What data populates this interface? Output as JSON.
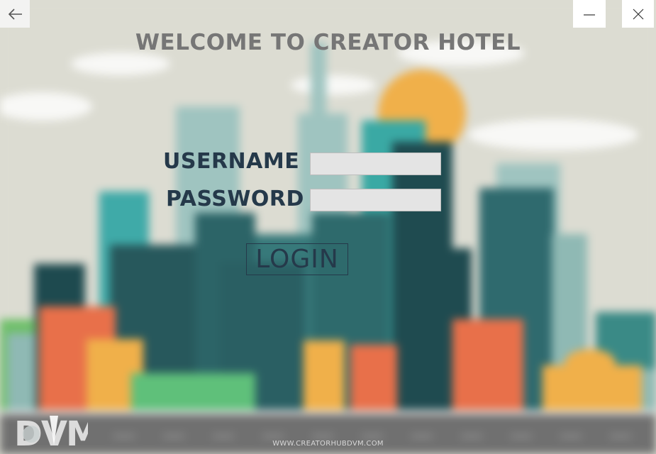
{
  "window": {
    "back_icon": "arrow-left-icon",
    "minimize_icon": "minimize-icon",
    "close_icon": "close-icon"
  },
  "header": {
    "title": "WELCOME TO CREATOR HOTEL"
  },
  "form": {
    "username_label": "USERNAME",
    "username_value": "",
    "password_label": "PASSWORD",
    "password_value": "",
    "login_label": "LOGIN"
  },
  "footer": {
    "logo_text": "DVM",
    "url": "WWW.CREATORHUBDVM.COM"
  },
  "colors": {
    "label": "#25394a",
    "title": "#767676",
    "field_bg": "#e4e4e4",
    "sky": "#dcdcd2"
  }
}
